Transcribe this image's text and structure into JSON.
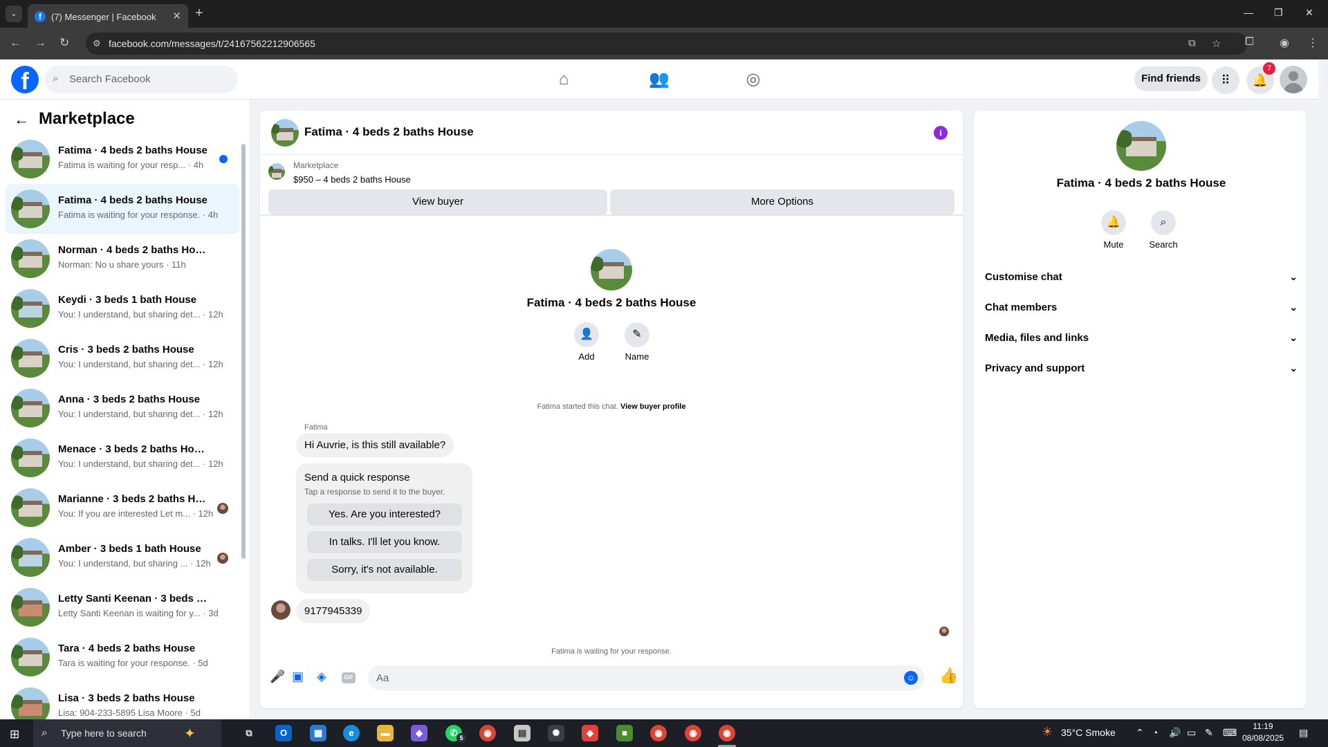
{
  "browser": {
    "tab_title": "(7) Messenger | Facebook",
    "url": "facebook.com/messages/t/24167562212906565"
  },
  "topnav": {
    "search_placeholder": "Search Facebook",
    "find_friends": "Find friends",
    "notification_count": "7"
  },
  "sidebar": {
    "title": "Marketplace",
    "chats": [
      {
        "name": "Fatima · 4 beds 2 baths House",
        "preview": "Fatima is waiting for your resp... · 4h"
      },
      {
        "name": "Fatima · 4 beds 2 baths House",
        "preview": "Fatima is waiting for your response. · 4h"
      },
      {
        "name": "Norman · 4 beds 2 baths House",
        "preview": "Norman: No u share yours · 11h"
      },
      {
        "name": "Keydi · 3 beds 1 bath House",
        "preview": "You: I understand, but sharing det... · 12h"
      },
      {
        "name": "Cris · 3 beds 2 baths House",
        "preview": "You: I understand, but sharing det... · 12h"
      },
      {
        "name": "Anna · 3 beds 2 baths House",
        "preview": "You: I understand, but sharing det... · 12h"
      },
      {
        "name": "Menace · 3 beds 2 baths House",
        "preview": "You: I understand, but sharing det... · 12h"
      },
      {
        "name": "Marianne · 3 beds 2 baths Ho...",
        "preview": "You: If you are interested Let m... · 12h"
      },
      {
        "name": "Amber · 3 beds 1 bath House",
        "preview": "You: I understand, but sharing ... · 12h"
      },
      {
        "name": "Letty Santi Keenan · 3 beds 2 bat...",
        "preview": "Letty Santi Keenan is waiting for y... · 3d"
      },
      {
        "name": "Tara · 4 beds 2 baths House",
        "preview": "Tara is waiting for your response. · 5d"
      },
      {
        "name": "Lisa · 3 beds 2 baths House",
        "preview": "Lisa: 904-233-5895 Lisa Moore · 5d"
      }
    ]
  },
  "chat": {
    "title": "Fatima · 4 beds 2 baths House",
    "listing_label": "Marketplace",
    "listing_price": "$950 – 4 beds 2 baths House",
    "view_buyer": "View buyer",
    "more_options": "More Options",
    "intro_title": "Fatima · 4 beds 2 baths House",
    "add_label": "Add",
    "name_label": "Name",
    "started_text": "Fatima started this chat.",
    "view_profile": "View buyer profile",
    "sender": "Fatima",
    "message1": "Hi Auvrie, is this still available?",
    "quick_title": "Send a quick response",
    "quick_sub": "Tap a response to send it to the buyer.",
    "quick_responses": [
      "Yes. Are you interested?",
      "In talks. I'll let you know.",
      "Sorry, it's not available."
    ],
    "message2": "9177945339",
    "waiting": "Fatima is waiting for your response.",
    "composer_placeholder": "Aa",
    "gif_label": "GIF"
  },
  "details": {
    "title": "Fatima · 4 beds 2 baths House",
    "mute": "Mute",
    "search": "Search",
    "sections": [
      "Customise chat",
      "Chat members",
      "Media, files and links",
      "Privacy and support"
    ]
  },
  "taskbar": {
    "search_placeholder": "Type here to search",
    "whatsapp_badge": "5",
    "weather": "35°C  Smoke",
    "time": "11:19",
    "date": "08/08/2025"
  },
  "colors": {
    "brand": "#0866ff",
    "badge": "#e41e3f",
    "info": "#8a2be2"
  }
}
